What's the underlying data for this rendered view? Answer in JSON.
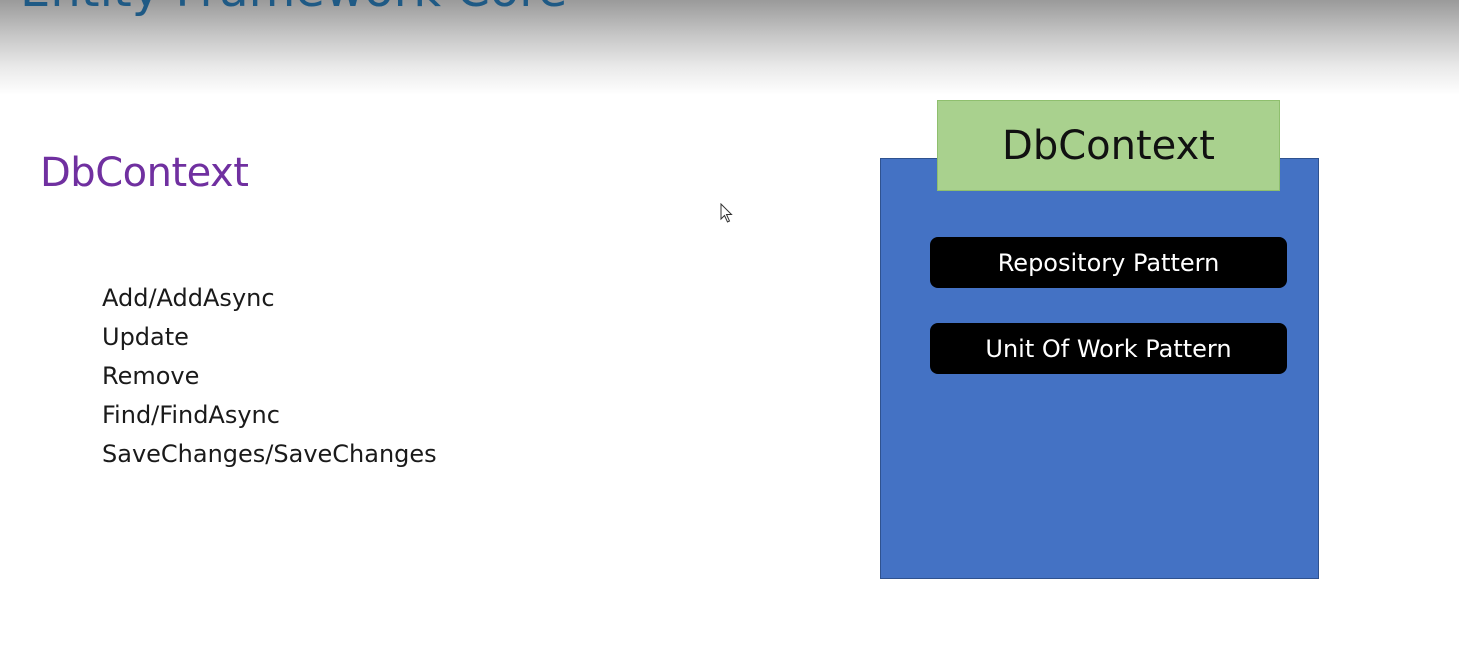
{
  "slide": {
    "title_fragment": "Entity Framework Core",
    "heading": "DbContext",
    "methods": [
      "Add/AddAsync",
      "Update",
      "Remove",
      "Find/FindAsync",
      "SaveChanges/SaveChanges"
    ]
  },
  "diagram": {
    "header": "DbContext",
    "patterns": [
      "Repository Pattern",
      "Unit Of Work Pattern"
    ]
  },
  "colors": {
    "heading": "#7030a0",
    "title": "#1f5a85",
    "box": "#4472c4",
    "header": "#a9d18e",
    "pattern_bg": "#000000"
  },
  "icons": {
    "cursor": "mouse-pointer-icon"
  }
}
